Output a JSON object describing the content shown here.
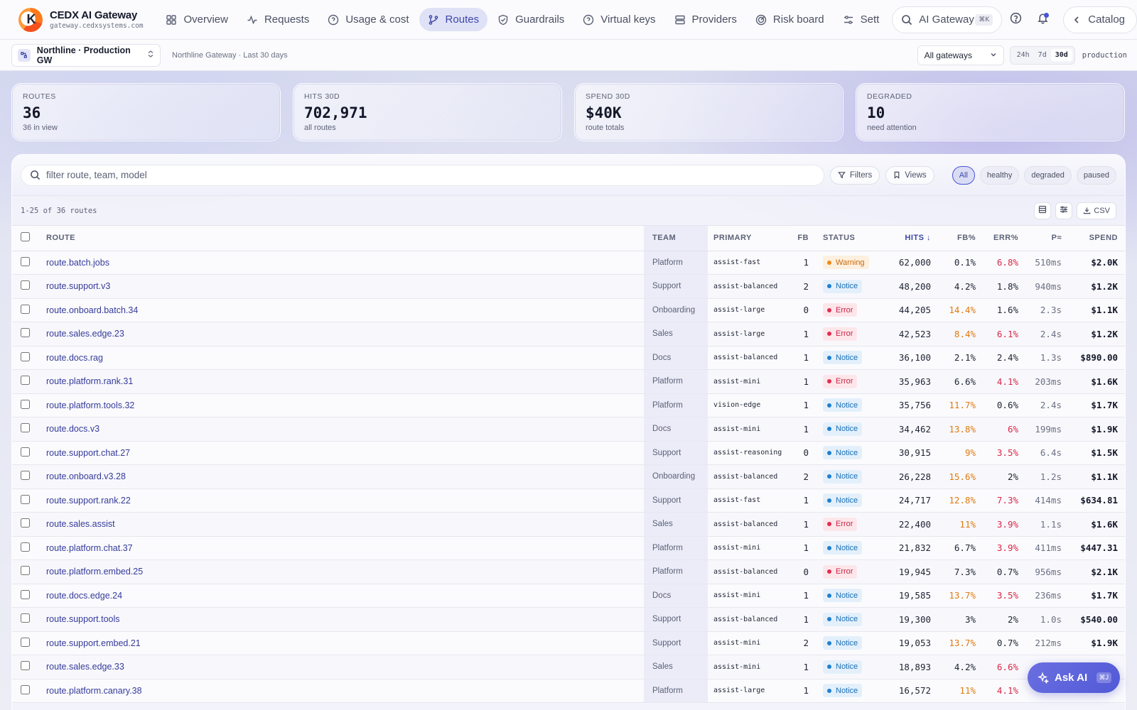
{
  "brand": {
    "title": "CEDX AI Gateway",
    "subtitle": "gateway.cedxsystems.com",
    "logo_letter": "K"
  },
  "nav": {
    "items": [
      {
        "label": "Overview",
        "icon": "grid-icon"
      },
      {
        "label": "Requests",
        "icon": "activity-icon"
      },
      {
        "label": "Usage & cost",
        "icon": "help-circle-icon"
      },
      {
        "label": "Routes",
        "icon": "git-branch-icon",
        "active": true
      },
      {
        "label": "Guardrails",
        "icon": "shield-icon"
      },
      {
        "label": "Virtual keys",
        "icon": "help-circle-icon"
      },
      {
        "label": "Providers",
        "icon": "server-icon"
      },
      {
        "label": "Risk board",
        "icon": "radar-icon"
      },
      {
        "label": "Sett",
        "icon": "sliders-icon"
      }
    ],
    "search_label": "AI Gateway",
    "search_kbd": "⌘K",
    "catalog_label": "Catalog"
  },
  "context": {
    "gateway_name": "Northline · Production GW",
    "gateway_sub": "Northline Gateway · Last 30 days",
    "all_gateways": "All gateways",
    "ranges": [
      "24h",
      "7d",
      "30d"
    ],
    "active_range": "30d",
    "env": "production"
  },
  "stats": [
    {
      "label": "ROUTES",
      "value": "36",
      "sub": "36 in view"
    },
    {
      "label": "HITS 30D",
      "value": "702,971",
      "sub": "all routes"
    },
    {
      "label": "SPEND 30D",
      "value": "$40K",
      "sub": "route totals"
    },
    {
      "label": "DEGRADED",
      "value": "10",
      "sub": "need attention"
    }
  ],
  "toolbar": {
    "filter_placeholder": "filter route, team, model",
    "filters_label": "Filters",
    "views_label": "Views",
    "segments": [
      "All",
      "healthy",
      "degraded",
      "paused"
    ],
    "active_segment": "All",
    "count_text": "1-25 of 36 routes",
    "csv_label": "CSV"
  },
  "table": {
    "headers": {
      "route": "ROUTE",
      "team": "TEAM",
      "primary": "PRIMARY",
      "fb": "FB",
      "status": "STATUS",
      "hits": "HITS ↓",
      "fbpct": "FB%",
      "errpct": "ERR%",
      "p": "P≈",
      "spend": "SPEND"
    },
    "rows": [
      {
        "route": "route.batch.jobs",
        "team": "Platform",
        "primary": "assist-fast",
        "fb": "1",
        "status": "Warning",
        "hits": "62,000",
        "fbpct": "0.1%",
        "fb_level": "normal",
        "errpct": "6.8%",
        "err_level": "bad",
        "p": "510ms",
        "spend": "$2.0K"
      },
      {
        "route": "route.support.v3",
        "team": "Support",
        "primary": "assist-balanced",
        "fb": "2",
        "status": "Notice",
        "hits": "48,200",
        "fbpct": "4.2%",
        "fb_level": "normal",
        "errpct": "1.8%",
        "err_level": "normal",
        "p": "940ms",
        "spend": "$1.2K"
      },
      {
        "route": "route.onboard.batch.34",
        "team": "Onboarding",
        "primary": "assist-large",
        "fb": "0",
        "status": "Error",
        "hits": "44,205",
        "fbpct": "14.4%",
        "fb_level": "warn",
        "errpct": "1.6%",
        "err_level": "normal",
        "p": "2.3s",
        "spend": "$1.1K"
      },
      {
        "route": "route.sales.edge.23",
        "team": "Sales",
        "primary": "assist-large",
        "fb": "1",
        "status": "Error",
        "hits": "42,523",
        "fbpct": "8.4%",
        "fb_level": "warn",
        "errpct": "6.1%",
        "err_level": "bad",
        "p": "2.4s",
        "spend": "$1.2K"
      },
      {
        "route": "route.docs.rag",
        "team": "Docs",
        "primary": "assist-balanced",
        "fb": "1",
        "status": "Notice",
        "hits": "36,100",
        "fbpct": "2.1%",
        "fb_level": "normal",
        "errpct": "2.4%",
        "err_level": "normal",
        "p": "1.3s",
        "spend": "$890.00"
      },
      {
        "route": "route.platform.rank.31",
        "team": "Platform",
        "primary": "assist-mini",
        "fb": "1",
        "status": "Error",
        "hits": "35,963",
        "fbpct": "6.6%",
        "fb_level": "normal",
        "errpct": "4.1%",
        "err_level": "bad",
        "p": "203ms",
        "spend": "$1.6K"
      },
      {
        "route": "route.platform.tools.32",
        "team": "Platform",
        "primary": "vision-edge",
        "fb": "1",
        "status": "Notice",
        "hits": "35,756",
        "fbpct": "11.7%",
        "fb_level": "warn",
        "errpct": "0.6%",
        "err_level": "normal",
        "p": "2.4s",
        "spend": "$1.7K"
      },
      {
        "route": "route.docs.v3",
        "team": "Docs",
        "primary": "assist-mini",
        "fb": "1",
        "status": "Notice",
        "hits": "34,462",
        "fbpct": "13.8%",
        "fb_level": "warn",
        "errpct": "6%",
        "err_level": "bad",
        "p": "199ms",
        "spend": "$1.9K"
      },
      {
        "route": "route.support.chat.27",
        "team": "Support",
        "primary": "assist-reasoning",
        "fb": "0",
        "status": "Notice",
        "hits": "30,915",
        "fbpct": "9%",
        "fb_level": "warn",
        "errpct": "3.5%",
        "err_level": "bad",
        "p": "6.4s",
        "spend": "$1.5K"
      },
      {
        "route": "route.onboard.v3.28",
        "team": "Onboarding",
        "primary": "assist-balanced",
        "fb": "2",
        "status": "Notice",
        "hits": "26,228",
        "fbpct": "15.6%",
        "fb_level": "warn",
        "errpct": "2%",
        "err_level": "normal",
        "p": "1.2s",
        "spend": "$1.1K"
      },
      {
        "route": "route.support.rank.22",
        "team": "Support",
        "primary": "assist-fast",
        "fb": "1",
        "status": "Notice",
        "hits": "24,717",
        "fbpct": "12.8%",
        "fb_level": "warn",
        "errpct": "7.3%",
        "err_level": "bad",
        "p": "414ms",
        "spend": "$634.81"
      },
      {
        "route": "route.sales.assist",
        "team": "Sales",
        "primary": "assist-balanced",
        "fb": "1",
        "status": "Error",
        "hits": "22,400",
        "fbpct": "11%",
        "fb_level": "warn",
        "errpct": "3.9%",
        "err_level": "bad",
        "p": "1.1s",
        "spend": "$1.6K"
      },
      {
        "route": "route.platform.chat.37",
        "team": "Platform",
        "primary": "assist-mini",
        "fb": "1",
        "status": "Notice",
        "hits": "21,832",
        "fbpct": "6.7%",
        "fb_level": "normal",
        "errpct": "3.9%",
        "err_level": "bad",
        "p": "411ms",
        "spend": "$447.31"
      },
      {
        "route": "route.platform.embed.25",
        "team": "Platform",
        "primary": "assist-balanced",
        "fb": "0",
        "status": "Error",
        "hits": "19,945",
        "fbpct": "7.3%",
        "fb_level": "normal",
        "errpct": "0.7%",
        "err_level": "normal",
        "p": "956ms",
        "spend": "$2.1K"
      },
      {
        "route": "route.docs.edge.24",
        "team": "Docs",
        "primary": "assist-mini",
        "fb": "1",
        "status": "Notice",
        "hits": "19,585",
        "fbpct": "13.7%",
        "fb_level": "warn",
        "errpct": "3.5%",
        "err_level": "bad",
        "p": "236ms",
        "spend": "$1.7K"
      },
      {
        "route": "route.support.tools",
        "team": "Support",
        "primary": "assist-balanced",
        "fb": "1",
        "status": "Notice",
        "hits": "19,300",
        "fbpct": "3%",
        "fb_level": "normal",
        "errpct": "2%",
        "err_level": "normal",
        "p": "1.0s",
        "spend": "$540.00"
      },
      {
        "route": "route.support.embed.21",
        "team": "Support",
        "primary": "assist-mini",
        "fb": "2",
        "status": "Notice",
        "hits": "19,053",
        "fbpct": "13.7%",
        "fb_level": "warn",
        "errpct": "0.7%",
        "err_level": "normal",
        "p": "212ms",
        "spend": "$1.9K"
      },
      {
        "route": "route.sales.edge.33",
        "team": "Sales",
        "primary": "assist-mini",
        "fb": "1",
        "status": "Notice",
        "hits": "18,893",
        "fbpct": "4.2%",
        "fb_level": "normal",
        "errpct": "6.6%",
        "err_level": "bad",
        "p": "",
        "spend": ""
      },
      {
        "route": "route.platform.canary.38",
        "team": "Platform",
        "primary": "assist-large",
        "fb": "1",
        "status": "Notice",
        "hits": "16,572",
        "fbpct": "11%",
        "fb_level": "warn",
        "errpct": "4.1%",
        "err_level": "bad",
        "p": "",
        "spend": ""
      }
    ]
  },
  "ask_ai": {
    "label": "Ask AI",
    "kbd": "⌘J"
  },
  "colors": {
    "accent": "#4a55d6",
    "warn": "#e07b12",
    "bad": "#d9284a",
    "notice": "#1a6fb5"
  }
}
